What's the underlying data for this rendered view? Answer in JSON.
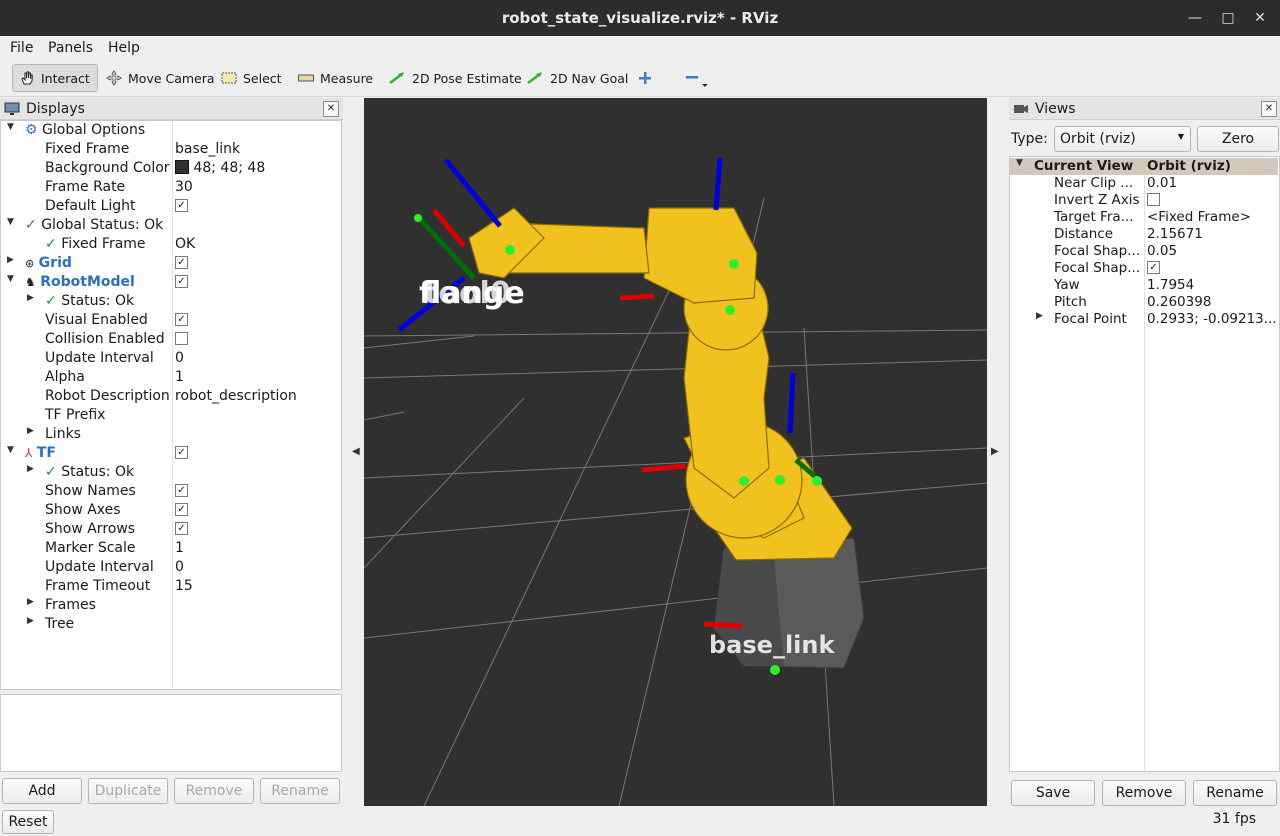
{
  "window": {
    "title": "robot_state_visualize.rviz* - RViz"
  },
  "menu": {
    "file": "File",
    "panels": "Panels",
    "help": "Help"
  },
  "toolbar": {
    "interact": "Interact",
    "move_camera": "Move Camera",
    "select": "Select",
    "measure": "Measure",
    "pose_estimate": "2D Pose Estimate",
    "nav_goal": "2D Nav Goal"
  },
  "displays": {
    "title": "Displays",
    "global_options": "Global Options",
    "fixed_frame_label": "Fixed Frame",
    "fixed_frame_value": "base_link",
    "bg_color_label": "Background Color",
    "bg_color_value": "48; 48; 48",
    "frame_rate_label": "Frame Rate",
    "frame_rate_value": "30",
    "default_light_label": "Default Light",
    "global_status": "Global Status: Ok",
    "gs_fixed_frame_label": "Fixed Frame",
    "gs_fixed_frame_value": "OK",
    "grid": "Grid",
    "robot_model": "RobotModel",
    "rm_status": "Status: Ok",
    "visual_enabled": "Visual Enabled",
    "collision_enabled": "Collision Enabled",
    "update_interval": "Update Interval",
    "update_interval_value": "0",
    "alpha": "Alpha",
    "alpha_value": "1",
    "robot_description": "Robot Description",
    "robot_description_value": "robot_description",
    "tf_prefix": "TF Prefix",
    "links": "Links",
    "tf": "TF",
    "tf_status": "Status: Ok",
    "show_names": "Show Names",
    "show_axes": "Show Axes",
    "show_arrows": "Show Arrows",
    "marker_scale": "Marker Scale",
    "marker_scale_value": "1",
    "tf_update_interval": "Update Interval",
    "tf_update_interval_value": "0",
    "frame_timeout": "Frame Timeout",
    "frame_timeout_value": "15",
    "frames": "Frames",
    "tree": "Tree",
    "buttons": {
      "add": "Add",
      "duplicate": "Duplicate",
      "remove": "Remove",
      "rename": "Rename"
    }
  },
  "views": {
    "title": "Views",
    "type_label": "Type:",
    "type_value": "Orbit (rviz)",
    "zero": "Zero",
    "current_view": "Current View",
    "current_view_value": "Orbit (rviz)",
    "props": [
      {
        "label": "Near Clip ...",
        "value": "0.01"
      },
      {
        "label": "Invert Z Axis",
        "value": ""
      },
      {
        "label": "Target Fra...",
        "value": "<Fixed Frame>"
      },
      {
        "label": "Distance",
        "value": "2.15671"
      },
      {
        "label": "Focal Shap...",
        "value": "0.05"
      },
      {
        "label": "Focal Shap...",
        "value": ""
      },
      {
        "label": "Yaw",
        "value": "1.7954"
      },
      {
        "label": "Pitch",
        "value": "0.260398"
      },
      {
        "label": "Focal Point",
        "value": "0.2933; -0.09213..."
      }
    ],
    "buttons": {
      "save": "Save",
      "remove": "Remove",
      "rename": "Rename"
    }
  },
  "viewport": {
    "tf_label_flange": "flange",
    "tf_label_tool": "tool0",
    "tf_label_base": "base_link"
  },
  "status": {
    "reset": "Reset",
    "fps": "31 fps"
  },
  "colors": {
    "background": "#303030",
    "robot": "#f0c020",
    "base": "#555555"
  }
}
